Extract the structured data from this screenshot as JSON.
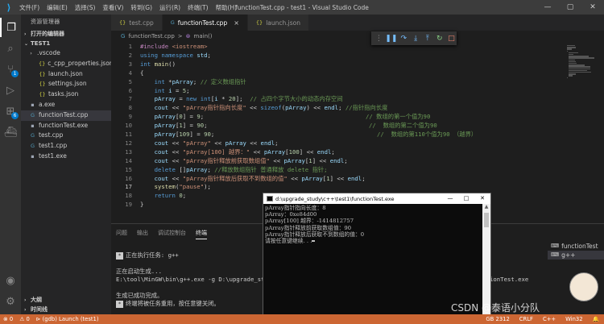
{
  "window": {
    "title": "functionTest.cpp - test1 - Visual Studio Code",
    "menu": [
      "文件(F)",
      "编辑(E)",
      "选择(S)",
      "查看(V)",
      "转到(G)",
      "运行(R)",
      "终端(T)",
      "帮助(H)"
    ],
    "controls": [
      "—",
      "▢",
      "✕"
    ]
  },
  "activity": {
    "badges": {
      "scm": "1",
      "debug": "6"
    }
  },
  "sidebar": {
    "title": "资源管理器",
    "open_editors": "打开的编辑器",
    "workspace": "TEST1",
    "items": [
      {
        "label": ".vscode",
        "type": "folder"
      },
      {
        "label": "c_cpp_properties.json",
        "type": "json"
      },
      {
        "label": "launch.json",
        "type": "json"
      },
      {
        "label": "settings.json",
        "type": "json"
      },
      {
        "label": "tasks.json",
        "type": "json"
      },
      {
        "label": "a.exe",
        "type": "exe"
      },
      {
        "label": "functionTest.cpp",
        "type": "cpp"
      },
      {
        "label": "functionTest.exe",
        "type": "exe"
      },
      {
        "label": "test.cpp",
        "type": "cpp"
      },
      {
        "label": "test1.cpp",
        "type": "cpp"
      },
      {
        "label": "test1.exe",
        "type": "exe"
      }
    ],
    "outline": "大纲",
    "timeline": "时间线"
  },
  "tabs": [
    {
      "label": "test.cpp",
      "icon": "{}"
    },
    {
      "label": "functionTest.cpp",
      "icon": "G",
      "active": true
    },
    {
      "label": "launch.json",
      "icon": "{}"
    }
  ],
  "breadcrumb": {
    "file": "functionTest.cpp",
    "sep": ">",
    "symbol": "main()"
  },
  "editor": {
    "current_line": "17",
    "lines": [
      {
        "n": "1",
        "text": "#include <iostream>"
      },
      {
        "n": "2",
        "text": "using namespace std;"
      },
      {
        "n": "3",
        "text": "int main()"
      },
      {
        "n": "4",
        "text": "{"
      },
      {
        "n": "5",
        "text": "    int *pArray; // 定义数组指针"
      },
      {
        "n": "6",
        "text": "    int i = 5;"
      },
      {
        "n": "7",
        "text": "    pArray = new int[i * 20];  // 占四个字节大小的动态内存空间"
      },
      {
        "n": "8",
        "text": "    cout << \"pArray指针指向长度\" << sizeof(pArray) << endl; //指针指向长度"
      },
      {
        "n": "9",
        "text": "    pArray[0] = 9;",
        "comment": "// 数组的第一个值为90"
      },
      {
        "n": "10",
        "text": "    pArray[1] = 90;",
        "comment": "//  数组的第二个值为90"
      },
      {
        "n": "11",
        "text": "    pArray[109] = 90;",
        "comment": "//  数组的第110个值为90 （越界）"
      },
      {
        "n": "12",
        "text": "    cout << \"pArray\" << pArray << endl;"
      },
      {
        "n": "13",
        "text": "    cout << \"pArray[100] 越界：\" << pArray[100] << endl;"
      },
      {
        "n": "14",
        "text": "    cout << \"pArray指针释放前获取数组值\" << pArray[1] << endl;"
      },
      {
        "n": "15",
        "text": "    delete []pArray; //释放数组指针 普通释放 delete 指针;"
      },
      {
        "n": "16",
        "text": "    cout << \"pArray指针释放后获取不到数组的值\" << pArray[1] << endl;"
      },
      {
        "n": "17",
        "text": "    system(\"pause\");"
      },
      {
        "n": "18",
        "text": "    return 0;"
      },
      {
        "n": "19",
        "text": "}"
      }
    ]
  },
  "panel": {
    "tabs": [
      "问题",
      "输出",
      "调试控制台",
      "终端"
    ],
    "active_tab": "终端",
    "terminal_lines": [
      {
        "badge": "*",
        "text": "正在执行任务: g++"
      },
      {
        "badge": "",
        "text": ""
      },
      {
        "badge": "",
        "text": "正在启动生成..."
      },
      {
        "badge": "",
        "text": "E:\\tool\\MinGW\\bin\\g++.exe -g D:\\upgrade_st"
      },
      {
        "badge": "",
        "text": ""
      },
      {
        "badge": "",
        "text": "生成已成功完成。"
      },
      {
        "badge": "*",
        "text": "终端将被任务重用，按任意键关闭。"
      }
    ],
    "terminal_tail": "ionTest.exe",
    "terminal_list": [
      {
        "label": "functionTest",
        "selected": false
      },
      {
        "label": "g++",
        "selected": true
      }
    ]
  },
  "console": {
    "title": "d:\\upgrade_study\\c++\\test1\\functionTest.exe",
    "lines": [
      "pArray指针指向长度：8",
      "pArray：0xe84d00",
      "pArray[100] 越界：-1414812757",
      "pArray指针释放前获取数组值：90",
      "pArray指针释放后获取不到数组的值：0",
      "请按任意键继续. . ."
    ]
  },
  "statusbar": {
    "errors": "⊗ 0",
    "warnings": "⚠ 0",
    "debug": "⊳ (gdb) Launch (test1)",
    "encoding": "GB 2312",
    "eol": "CRLF",
    "language": "C++",
    "platform": "Win32"
  },
  "watermark": "CSDN @泰语小分队"
}
